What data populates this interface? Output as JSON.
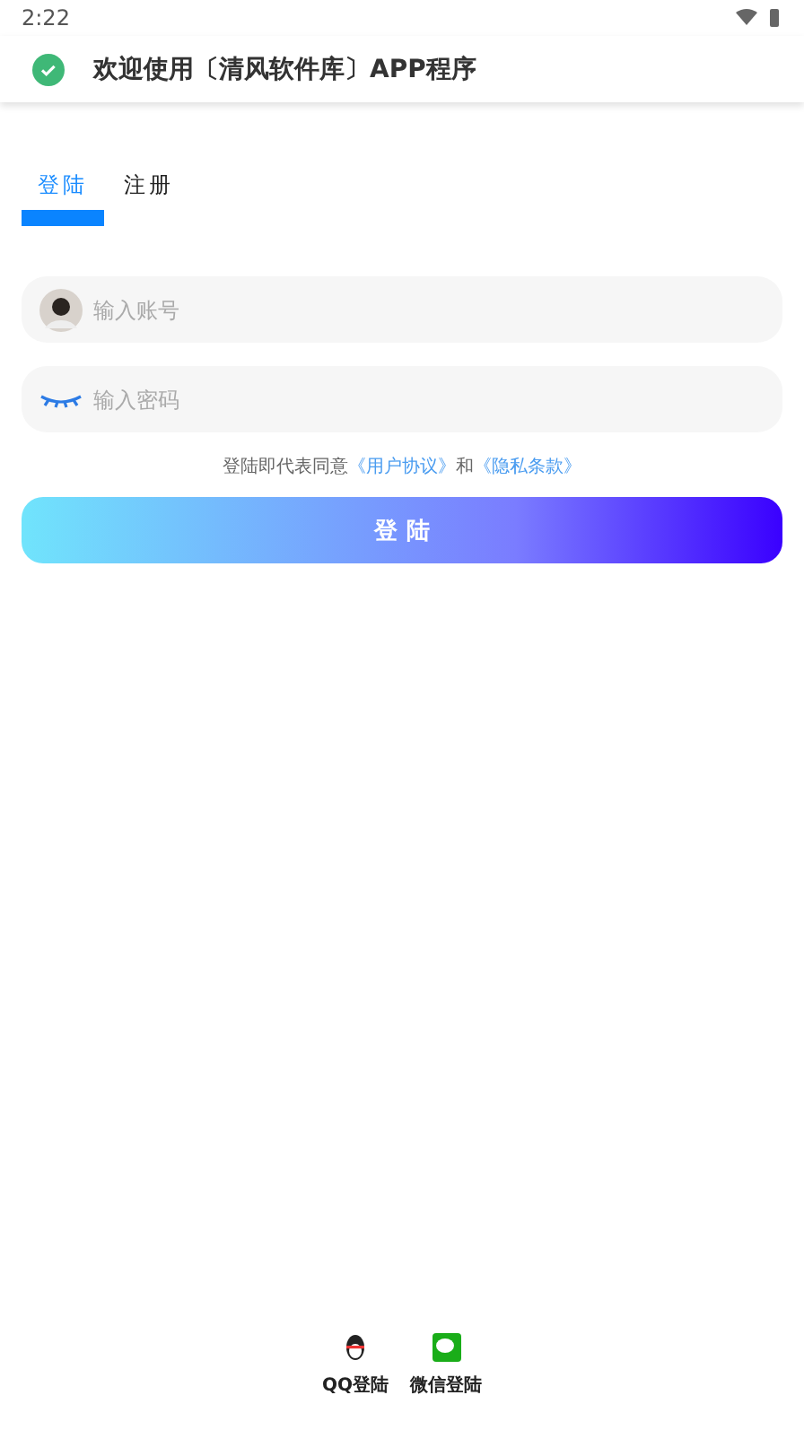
{
  "status_bar": {
    "time": "2:22"
  },
  "header": {
    "title": "欢迎使用〔清风软件库〕APP程序"
  },
  "tabs": [
    {
      "label": "登陆",
      "selected": true
    },
    {
      "label": "注册",
      "selected": false
    }
  ],
  "fields": [
    {
      "kind": "account",
      "placeholder": "输入账号"
    },
    {
      "kind": "password",
      "placeholder": "输入密码"
    }
  ],
  "agreement": {
    "text": "登陆即代表同意",
    "link_1": "《用户协议》",
    "joiner": "和",
    "link_2": "《隐私条款》"
  },
  "login_button": "登 陆",
  "social_logins": [
    {
      "kind": "qq",
      "label": "QQ登陆"
    },
    {
      "kind": "wechat",
      "label": "微信登陆"
    }
  ]
}
